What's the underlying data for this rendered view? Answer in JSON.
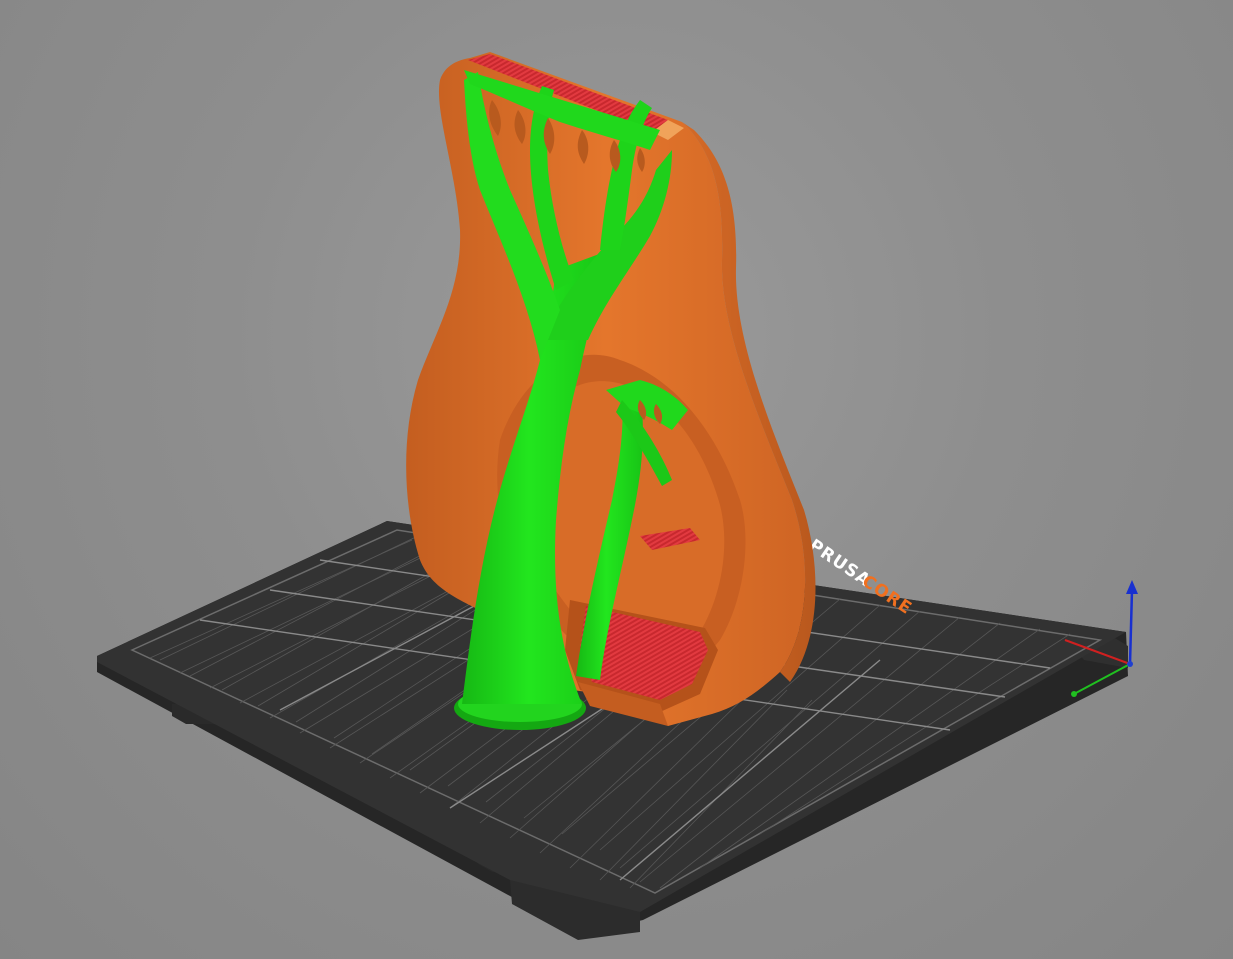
{
  "viewport": {
    "background": "#8e8e8e"
  },
  "bed": {
    "brand_primary": "PRUSA",
    "brand_secondary": "CORE",
    "plate_color": "#2e2e2e",
    "grid_color": "#7a7a7a",
    "brand_primary_color": "#ffffff",
    "brand_secondary_color": "#f07020"
  },
  "model": {
    "perimeter_color": "#e0722a",
    "perimeter_shadow_color": "#b85a1e",
    "infill_color": "#d8323a",
    "support_color": "#1ee01a",
    "support_shadow_color": "#12a812"
  },
  "axes": {
    "x_color": "#d02020",
    "y_color": "#20c020",
    "z_color": "#1830d0"
  }
}
